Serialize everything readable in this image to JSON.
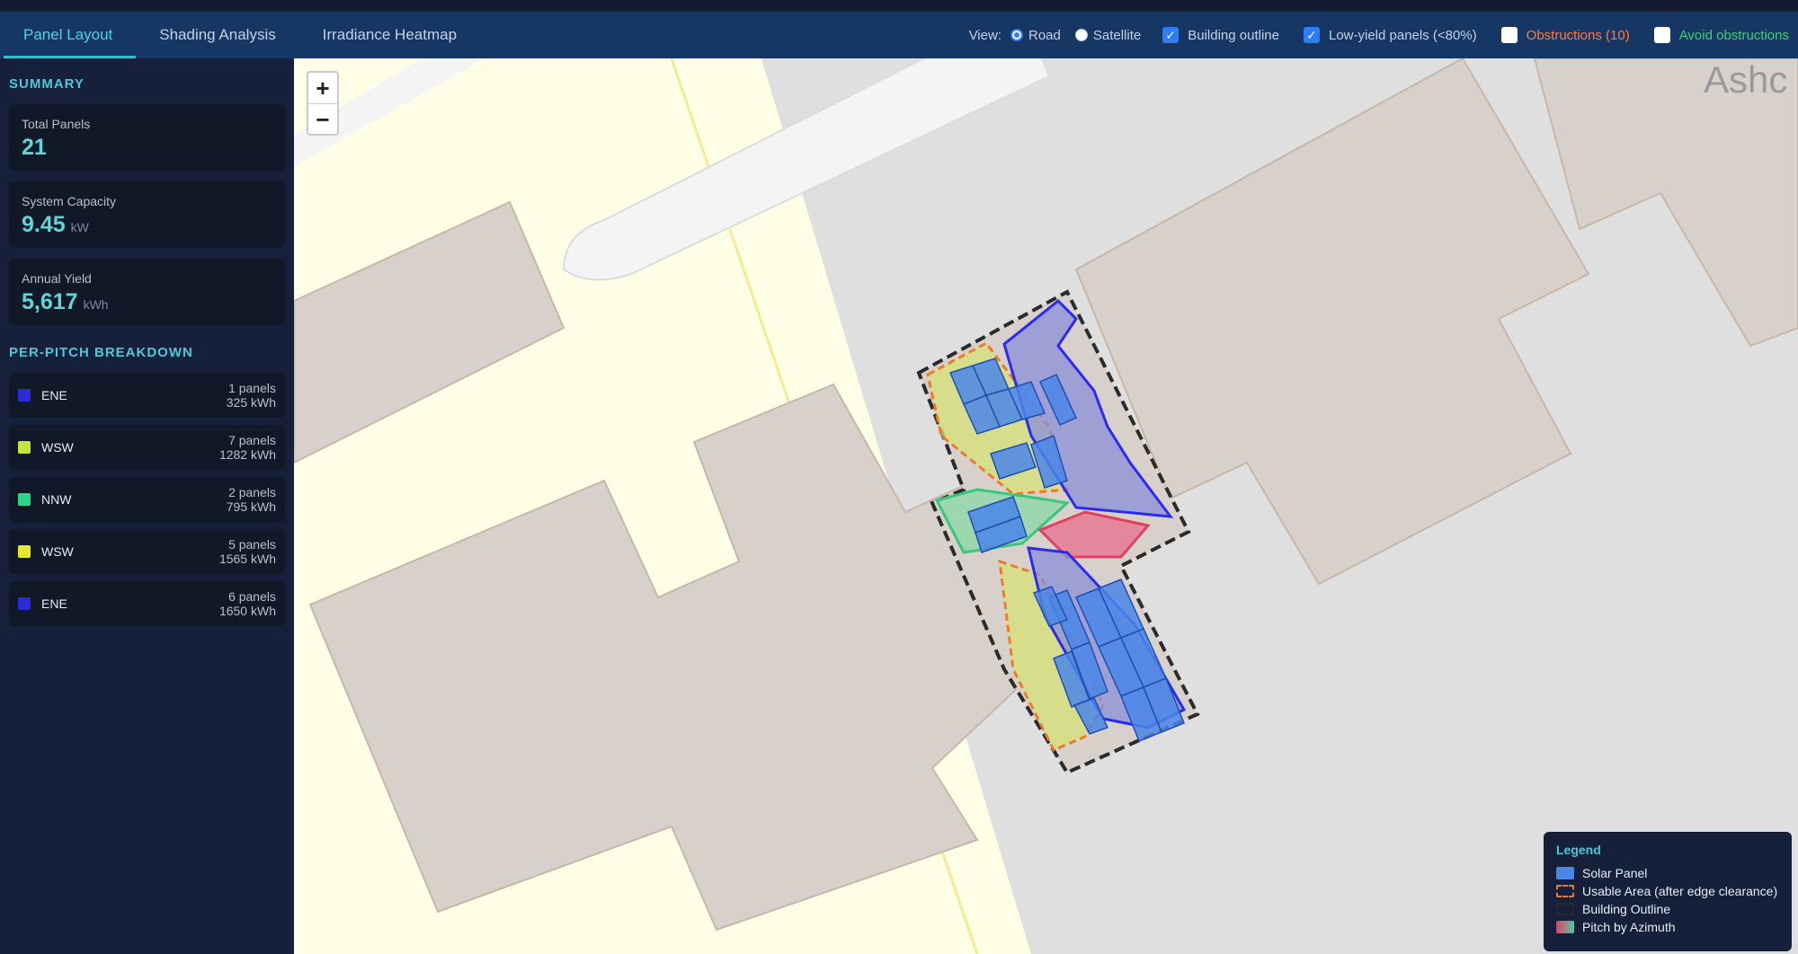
{
  "tabs": [
    {
      "label": "Panel Layout"
    },
    {
      "label": "Shading Analysis"
    },
    {
      "label": "Irradiance Heatmap"
    }
  ],
  "view": {
    "label": "View:",
    "road": "Road",
    "satellite": "Satellite",
    "building_outline": "Building outline",
    "low_yield": "Low-yield panels (<80%)",
    "obstructions": "Obstructions (10)",
    "avoid_obstructions": "Avoid obstructions"
  },
  "summary": {
    "title": "SUMMARY",
    "total_panels_label": "Total Panels",
    "total_panels": "21",
    "capacity_label": "System Capacity",
    "capacity": "9.45",
    "capacity_unit": "kW",
    "yield_label": "Annual Yield",
    "yield": "5,617",
    "yield_unit": "kWh"
  },
  "breakdown": {
    "title": "PER-PITCH BREAKDOWN",
    "items": [
      {
        "name": "ENE",
        "color": "#2b2bd9",
        "panels": "1 panels",
        "kwh": "325 kWh"
      },
      {
        "name": "WSW",
        "color": "#c9e33c",
        "panels": "7 panels",
        "kwh": "1282 kWh"
      },
      {
        "name": "NNW",
        "color": "#2fd38a",
        "panels": "2 panels",
        "kwh": "795 kWh"
      },
      {
        "name": "WSW",
        "color": "#e4e82e",
        "panels": "5 panels",
        "kwh": "1565 kWh"
      },
      {
        "name": "ENE",
        "color": "#2b2bd9",
        "panels": "6 panels",
        "kwh": "1650 kWh"
      }
    ]
  },
  "map": {
    "zoom_in": "+",
    "zoom_out": "−",
    "place_label": "Ashc"
  },
  "legend": {
    "title": "Legend",
    "solar_panel": "Solar Panel",
    "usable_area": "Usable Area (after edge clearance)",
    "building_outline": "Building Outline",
    "pitch_by_azimuth": "Pitch by Azimuth"
  },
  "colors": {
    "accent": "#4fc7d8",
    "panel": "#4a86e8",
    "usable": "#f07a2a",
    "obstruction": "#ff7a45",
    "avoid": "#3fcf74"
  }
}
